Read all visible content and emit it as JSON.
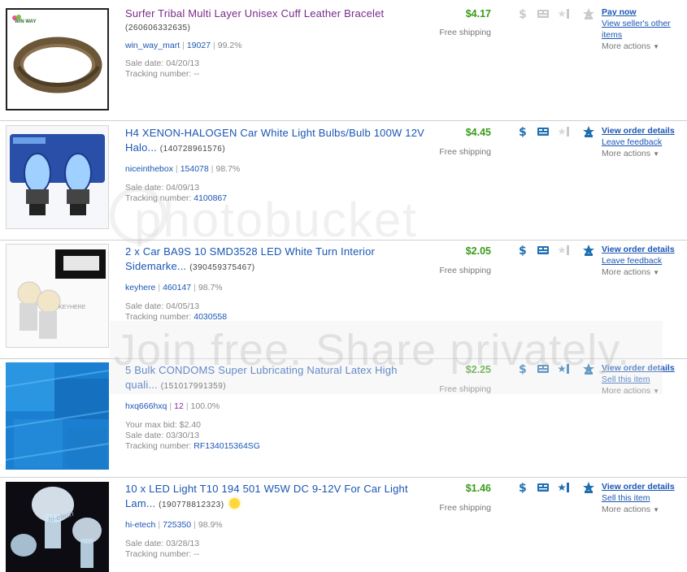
{
  "rows": [
    {
      "title": "Surfer Tribal Multi Layer Unisex Cuff Leather Bracelet",
      "title_color": "#7a2a8c",
      "item_id": "(260606332635)",
      "seller": "win_way_mart",
      "feedback": "19027",
      "percent": "99.2%",
      "sale_date": "Sale date: 04/20/13",
      "tracking_label": "Tracking number:",
      "tracking": "--",
      "price": "$4.17",
      "price_color": "#3a9b19",
      "shipping": "Free shipping",
      "icons": [
        "dollar-icon",
        "truck-icon",
        "feedback-star-icon",
        "feedback-leave-icon"
      ],
      "icons_active": false,
      "action_primary": "Pay now",
      "action_secondary": "View seller's other items",
      "more": "More actions"
    },
    {
      "title": "H4 XENON-HALOGEN Car White Light Bulbs/Bulb 100W 12V Halo...",
      "title_color": "#1a56b4",
      "item_id": "(140728961576)",
      "seller": "niceinthebox",
      "feedback": "154078",
      "percent": "98.7%",
      "sale_date": "Sale date: 04/09/13",
      "tracking_label": "Tracking number:",
      "tracking": "4100867",
      "price": "$4.45",
      "price_color": "#3a9b19",
      "shipping": "Free shipping",
      "icons": [
        "dollar-icon",
        "truck-icon",
        "feedback-star-icon",
        "feedback-leave-icon"
      ],
      "icons_active": true,
      "action_primary": "View order details",
      "action_secondary": "Leave feedback",
      "more": "More actions"
    },
    {
      "title": "2 x Car BA9S 10 SMD3528 LED White Turn Interior Sidemarke...",
      "title_color": "#1a56b4",
      "item_id": "(390459375467)",
      "seller": "keyhere",
      "feedback": "460147",
      "percent": "98.7%",
      "sale_date": "Sale date: 04/05/13",
      "tracking_label": "Tracking number:",
      "tracking": "4030558",
      "price": "$2.05",
      "price_color": "#3a9b19",
      "shipping": "Free shipping",
      "icons": [
        "dollar-icon",
        "truck-icon",
        "feedback-star-icon",
        "feedback-leave-icon"
      ],
      "icons_active": true,
      "action_primary": "View order details",
      "action_secondary": "Leave feedback",
      "more": "More actions"
    },
    {
      "title": "5 Bulk CONDOMS Super Lubricating Natural Latex High quali...",
      "title_color": "#1a56b4",
      "item_id": "(151017991359)",
      "seller": "hxq666hxq",
      "feedback": "12",
      "percent": "100.0%",
      "max_bid": "Your max bid: $2.40",
      "sale_date": "Sale date: 03/30/13",
      "tracking_label": "Tracking number:",
      "tracking": "RF134015364SG",
      "price": "$2.25",
      "price_color": "#3a9b19",
      "shipping": "Free shipping",
      "icons": [
        "dollar-icon",
        "truck-icon",
        "feedback-star-icon",
        "feedback-leave-icon"
      ],
      "icons_active": true,
      "action_primary": "View order details",
      "action_secondary": "Sell this item",
      "more": "More actions"
    },
    {
      "title": "10 x LED Light T10 194 501 W5W DC 9-12V For Car Light Lam...",
      "title_color": "#1a56b4",
      "item_id": "(190778812323)",
      "seller": "hi-etech",
      "feedback": "725350",
      "percent": "98.9%",
      "sale_date": "Sale date: 03/28/13",
      "tracking_label": "Tracking number:",
      "tracking": "--",
      "price": "$1.46",
      "price_color": "#3a9b19",
      "shipping": "Free shipping",
      "icons": [
        "dollar-icon",
        "truck-icon",
        "feedback-star-icon",
        "feedback-leave-icon"
      ],
      "icons_active": true,
      "action_primary": "View order details",
      "action_secondary": "Sell this item",
      "more": "More actions"
    }
  ],
  "thumb_logos": {
    "row0": "WIN WAY",
    "row2": "KEYHERE",
    "row4": "hi-etech"
  },
  "watermark": {
    "logo": "photobucket",
    "tagline": "Join free. Share privately."
  },
  "colors": {
    "link": "#1a56b4",
    "price": "#3a9b19",
    "icon_active": "#1f6fb0",
    "icon_inactive": "#c9c9c9"
  }
}
